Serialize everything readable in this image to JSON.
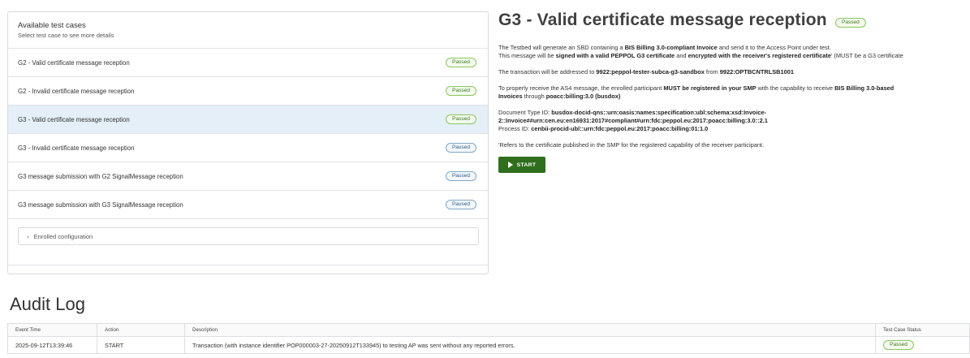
{
  "test_cases_panel": {
    "title": "Available test cases",
    "subtitle": "Select test case to see more details",
    "items": [
      {
        "name": "G2 - Valid certificate message reception",
        "status": "Passed"
      },
      {
        "name": "G2 - Invalid certificate message reception",
        "status": "Passed"
      },
      {
        "name": "G3 - Valid certificate message reception",
        "status": "Passed"
      },
      {
        "name": "G3 - Invalid certificate message reception",
        "status": "Paused"
      },
      {
        "name": "G3 message submission with G2 SignalMessage reception",
        "status": "Paused"
      },
      {
        "name": "G3 message submission with G3 SignalMessage reception",
        "status": "Paused"
      }
    ],
    "selected_index": 2,
    "enrolled_configuration_label": "Enrolled configuration"
  },
  "detail": {
    "title": "G3 - Valid certificate message reception",
    "status": "Passed",
    "p1a_1": "The Testbed will generate an SBD containing a ",
    "p1a_b1": "BIS Billing 3.0-compliant Invoice",
    "p1a_2": " and send it to the Access Point under test.",
    "p1b_1": "This message will be ",
    "p1b_b1": "signed with a valid PEPPOL G3 certificate",
    "p1b_2": " and ",
    "p1b_b2": "encrypted with the receiver's registered certificate",
    "p1b_3": "' (MUST be a G3 certificate",
    "p2_1": "The transaction will be addressed to ",
    "p2_b1": "9922:peppol-tester-subca-g3-sandbox",
    "p2_2": " from ",
    "p2_b2": "9922:OPTBCNTRLSB1001",
    "p3a_1": "To properly receive the AS4 message, the enrolled participant ",
    "p3a_b1": "MUST be registered in your SMP",
    "p3a_2": " with the capability to receive ",
    "p3a_b2": "BIS Billing 3.0-based",
    "p3b_b1": "Invoices",
    "p3b_1": " through ",
    "p3b_b2": "poacc:billing:3.0 (busdox)",
    "doc_type_label": "Document Type ID: ",
    "doc_type_line1": "busdox-docid-qns::urn:oasis:names:specification:ubl:schema:xsd:Invoice-",
    "doc_type_line2": "2::Invoice##urn:cen.eu:en16931:2017#compliant#urn:fdc:peppol.eu:2017:poacc:billing:3.0::2.1",
    "process_label": "Process ID: ",
    "process_value": "cenbii-procid-ubl::urn:fdc:peppol.eu:2017:poacc:billing:01:1.0",
    "footnote": "'Refers to the certificate published in the SMP for the registered capability of the receiver participant.",
    "start_button": "START"
  },
  "audit_log": {
    "title": "Audit Log",
    "columns": [
      "Event Time",
      "Action",
      "Description",
      "Test Case Status"
    ],
    "rows": [
      {
        "time": "2025-09-12T13:39:46",
        "action": "START",
        "description": "Transaction (with instance identifier POP000003-27-20250912T133945) to testing AP was sent without any reported errors.",
        "status": "Passed"
      }
    ]
  },
  "colors": {
    "passed": "#3e7a1b",
    "paused": "#2d5f8a",
    "start_button": "#2f6e1d",
    "selected_row": "#e4eff7"
  },
  "icons": {
    "enrolled_toggle": "chevron-right-icon",
    "start": "play-icon"
  }
}
